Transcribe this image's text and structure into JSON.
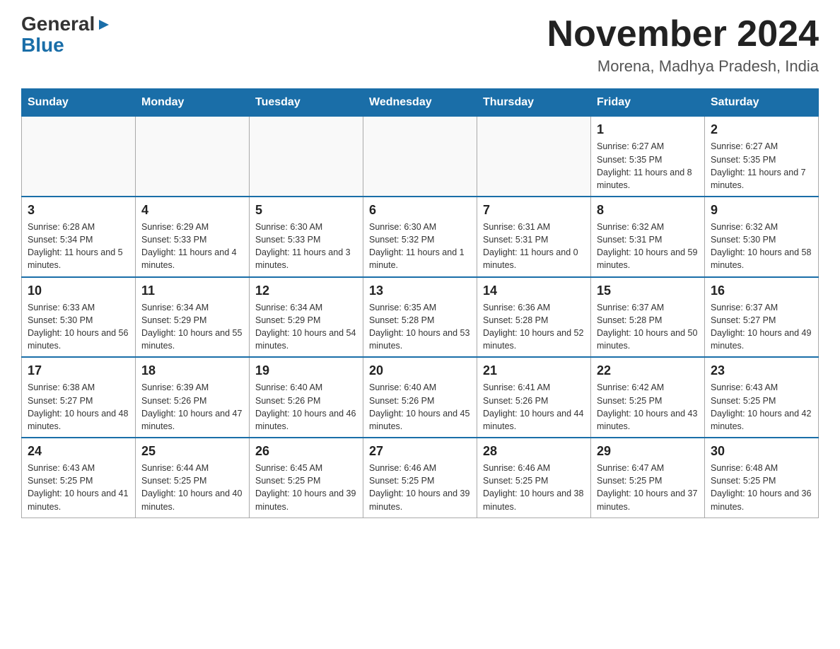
{
  "logo": {
    "general": "General",
    "blue": "Blue"
  },
  "header": {
    "month": "November 2024",
    "location": "Morena, Madhya Pradesh, India"
  },
  "weekdays": [
    "Sunday",
    "Monday",
    "Tuesday",
    "Wednesday",
    "Thursday",
    "Friday",
    "Saturday"
  ],
  "rows": [
    [
      {
        "day": "",
        "info": ""
      },
      {
        "day": "",
        "info": ""
      },
      {
        "day": "",
        "info": ""
      },
      {
        "day": "",
        "info": ""
      },
      {
        "day": "",
        "info": ""
      },
      {
        "day": "1",
        "info": "Sunrise: 6:27 AM\nSunset: 5:35 PM\nDaylight: 11 hours and 8 minutes."
      },
      {
        "day": "2",
        "info": "Sunrise: 6:27 AM\nSunset: 5:35 PM\nDaylight: 11 hours and 7 minutes."
      }
    ],
    [
      {
        "day": "3",
        "info": "Sunrise: 6:28 AM\nSunset: 5:34 PM\nDaylight: 11 hours and 5 minutes."
      },
      {
        "day": "4",
        "info": "Sunrise: 6:29 AM\nSunset: 5:33 PM\nDaylight: 11 hours and 4 minutes."
      },
      {
        "day": "5",
        "info": "Sunrise: 6:30 AM\nSunset: 5:33 PM\nDaylight: 11 hours and 3 minutes."
      },
      {
        "day": "6",
        "info": "Sunrise: 6:30 AM\nSunset: 5:32 PM\nDaylight: 11 hours and 1 minute."
      },
      {
        "day": "7",
        "info": "Sunrise: 6:31 AM\nSunset: 5:31 PM\nDaylight: 11 hours and 0 minutes."
      },
      {
        "day": "8",
        "info": "Sunrise: 6:32 AM\nSunset: 5:31 PM\nDaylight: 10 hours and 59 minutes."
      },
      {
        "day": "9",
        "info": "Sunrise: 6:32 AM\nSunset: 5:30 PM\nDaylight: 10 hours and 58 minutes."
      }
    ],
    [
      {
        "day": "10",
        "info": "Sunrise: 6:33 AM\nSunset: 5:30 PM\nDaylight: 10 hours and 56 minutes."
      },
      {
        "day": "11",
        "info": "Sunrise: 6:34 AM\nSunset: 5:29 PM\nDaylight: 10 hours and 55 minutes."
      },
      {
        "day": "12",
        "info": "Sunrise: 6:34 AM\nSunset: 5:29 PM\nDaylight: 10 hours and 54 minutes."
      },
      {
        "day": "13",
        "info": "Sunrise: 6:35 AM\nSunset: 5:28 PM\nDaylight: 10 hours and 53 minutes."
      },
      {
        "day": "14",
        "info": "Sunrise: 6:36 AM\nSunset: 5:28 PM\nDaylight: 10 hours and 52 minutes."
      },
      {
        "day": "15",
        "info": "Sunrise: 6:37 AM\nSunset: 5:28 PM\nDaylight: 10 hours and 50 minutes."
      },
      {
        "day": "16",
        "info": "Sunrise: 6:37 AM\nSunset: 5:27 PM\nDaylight: 10 hours and 49 minutes."
      }
    ],
    [
      {
        "day": "17",
        "info": "Sunrise: 6:38 AM\nSunset: 5:27 PM\nDaylight: 10 hours and 48 minutes."
      },
      {
        "day": "18",
        "info": "Sunrise: 6:39 AM\nSunset: 5:26 PM\nDaylight: 10 hours and 47 minutes."
      },
      {
        "day": "19",
        "info": "Sunrise: 6:40 AM\nSunset: 5:26 PM\nDaylight: 10 hours and 46 minutes."
      },
      {
        "day": "20",
        "info": "Sunrise: 6:40 AM\nSunset: 5:26 PM\nDaylight: 10 hours and 45 minutes."
      },
      {
        "day": "21",
        "info": "Sunrise: 6:41 AM\nSunset: 5:26 PM\nDaylight: 10 hours and 44 minutes."
      },
      {
        "day": "22",
        "info": "Sunrise: 6:42 AM\nSunset: 5:25 PM\nDaylight: 10 hours and 43 minutes."
      },
      {
        "day": "23",
        "info": "Sunrise: 6:43 AM\nSunset: 5:25 PM\nDaylight: 10 hours and 42 minutes."
      }
    ],
    [
      {
        "day": "24",
        "info": "Sunrise: 6:43 AM\nSunset: 5:25 PM\nDaylight: 10 hours and 41 minutes."
      },
      {
        "day": "25",
        "info": "Sunrise: 6:44 AM\nSunset: 5:25 PM\nDaylight: 10 hours and 40 minutes."
      },
      {
        "day": "26",
        "info": "Sunrise: 6:45 AM\nSunset: 5:25 PM\nDaylight: 10 hours and 39 minutes."
      },
      {
        "day": "27",
        "info": "Sunrise: 6:46 AM\nSunset: 5:25 PM\nDaylight: 10 hours and 39 minutes."
      },
      {
        "day": "28",
        "info": "Sunrise: 6:46 AM\nSunset: 5:25 PM\nDaylight: 10 hours and 38 minutes."
      },
      {
        "day": "29",
        "info": "Sunrise: 6:47 AM\nSunset: 5:25 PM\nDaylight: 10 hours and 37 minutes."
      },
      {
        "day": "30",
        "info": "Sunrise: 6:48 AM\nSunset: 5:25 PM\nDaylight: 10 hours and 36 minutes."
      }
    ]
  ]
}
